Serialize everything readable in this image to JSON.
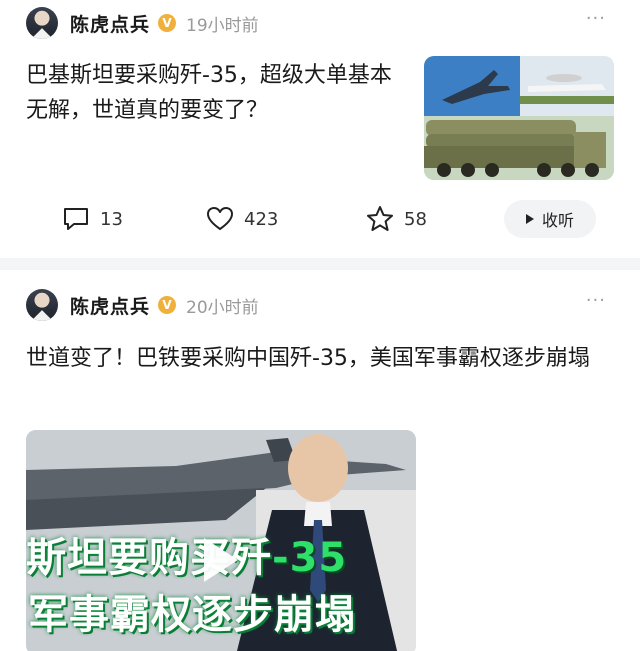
{
  "posts": [
    {
      "author": "陈虎点兵",
      "time": "19小时前",
      "more": "···",
      "title": "巴基斯坦要采购歼-35，超级大单基本无解，世道真的要变了？",
      "thumbnail_icon": "military-aircraft-image",
      "actions": {
        "comments": "13",
        "likes": "423",
        "favorites": "58",
        "listen": "收听"
      }
    },
    {
      "author": "陈虎点兵",
      "time": "20小时前",
      "more": "···",
      "title": "世道变了！巴铁要采购中国歼-35，美国军事霸权逐步崩塌",
      "video": {
        "overlay_line1_a": "斯坦要购",
        "overlay_line1_b": "买歼",
        "overlay_line1_c": "-35",
        "overlay_line2": "军事霸权逐步崩塌"
      }
    }
  ],
  "colors": {
    "badge": "#f0b13c",
    "overlay_green": "#2ee06a",
    "divider": "#f4f5f6"
  }
}
